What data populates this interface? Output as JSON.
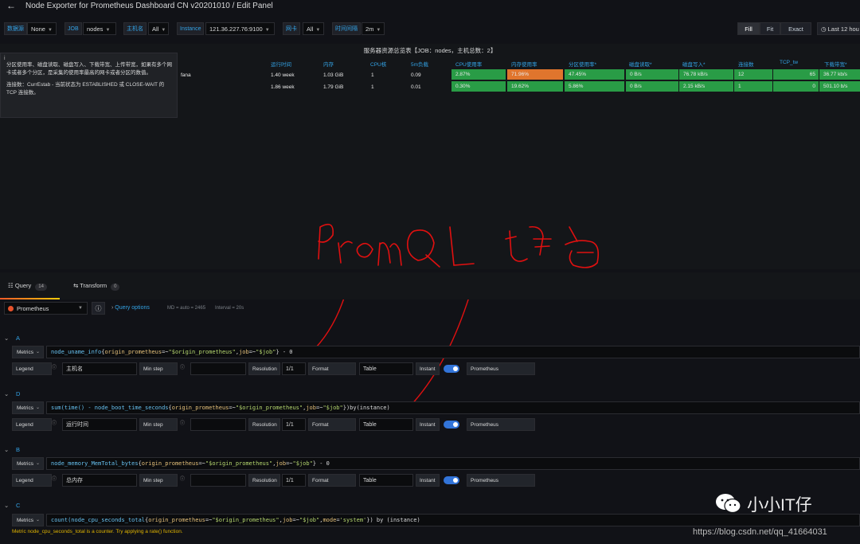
{
  "header": {
    "back_icon": "arrow-left-icon",
    "title": "Node Exporter for Prometheus Dashboard CN v20201010 / Edit Panel"
  },
  "variables": [
    {
      "label": "数据源",
      "value": "None"
    },
    {
      "label": "JOB",
      "value": "nodes"
    },
    {
      "label": "主机名",
      "value": "All"
    },
    {
      "label": "Instance",
      "value": "121.36.227.76:9100"
    },
    {
      "label": "网卡",
      "value": "All"
    },
    {
      "label": "时间间隔",
      "value": "2m"
    }
  ],
  "view_modes": [
    "Fill",
    "Fit",
    "Exact"
  ],
  "time_picker": "Last 12 hou",
  "panel": {
    "title": "服务器资源总览表【JOB：nodes，主机总数：2】",
    "columns": [
      "运行时间",
      "内存",
      "CPU核",
      "5m负载",
      "CPU使用率",
      "内存使用率",
      "分区使用率*",
      "磁盘读取*",
      "磁盘写入*",
      "连接数",
      "TCP_tw",
      "下载带宽*"
    ],
    "rows": [
      {
        "name_fragment": "fana",
        "cells": [
          "1.40 week",
          "1.03 GiB",
          "1",
          "0.09",
          "2.87%",
          "71.96%",
          "47.45%",
          "0 B/s",
          "76.78 kB/s",
          "12",
          "65",
          "36.77 kb/s"
        ]
      },
      {
        "name_fragment": "",
        "cells": [
          "1.86 week",
          "1.79 GiB",
          "1",
          "0.01",
          "0.30%",
          "19.62%",
          "5.86%",
          "0 B/s",
          "2.15 kB/s",
          "1",
          "0",
          "501.10 b/s"
        ]
      }
    ],
    "tooltip": {
      "p1": "分区使用率、磁盘读取、磁盘写入、下载带宽、上传带宽，如果有多个网卡或者多个分区，是采集的使用率最高的网卡或者分区的数值。",
      "p2": "连接数：CurrEstab - 当前状态为 ESTABLISHED 或 CLOSE-WAIT 的 TCP 连接数。"
    },
    "annotation": "PromQL 语句"
  },
  "tabs": [
    {
      "label": "Query",
      "count": "14"
    },
    {
      "label": "Transform",
      "count": "0"
    }
  ],
  "datasource": {
    "name": "Prometheus",
    "query_options": "Query options",
    "md": "MD = auto = 2465",
    "interval": "Interval = 20s"
  },
  "labels": {
    "metrics": "Metrics",
    "legend": "Legend",
    "min_step": "Min step",
    "resolution": "Resolution",
    "resolution_value": "1/1",
    "format": "Format",
    "instant": "Instant",
    "prometheus": "Prometheus",
    "info_icon": "ⓘ"
  },
  "queries": [
    {
      "id": "A",
      "expr_parts": [
        "node_uname_info",
        "{",
        "origin_prometheus",
        "=~",
        "\"$origin_prometheus\"",
        ",",
        "job",
        "=~",
        "\"$job\"",
        "} - 0"
      ],
      "legend": "主机名",
      "format": "Table"
    },
    {
      "id": "D",
      "expr_parts": [
        "sum(time() - ",
        "node_boot_time_seconds",
        "{",
        "origin_prometheus",
        "=~",
        "\"$origin_prometheus\"",
        ",",
        "job",
        "=~",
        "\"$job\"",
        "})by(instance)"
      ],
      "legend": "运行时间",
      "format": "Table"
    },
    {
      "id": "B",
      "expr_parts": [
        "node_memory_MemTotal_bytes",
        "{",
        "origin_prometheus",
        "=~",
        "\"$origin_prometheus\"",
        ",",
        "job",
        "=~",
        "\"$job\"",
        "} - 0"
      ],
      "legend": "总内存",
      "format": "Table"
    },
    {
      "id": "C",
      "expr_parts": [
        "count(",
        "node_cpu_seconds_total",
        "{",
        "origin_prometheus",
        "=~",
        "\"$origin_prometheus\"",
        ",",
        "job",
        "=~",
        "\"$job\"",
        ",",
        "mode",
        "=",
        "'system'",
        "}) by (instance)"
      ],
      "warning": "Metric node_cpu_seconds_total is a counter. Try applying a rate() function."
    }
  ],
  "watermark": {
    "text": "小小IT仔",
    "url": "https://blog.csdn.net/qq_41664031"
  }
}
